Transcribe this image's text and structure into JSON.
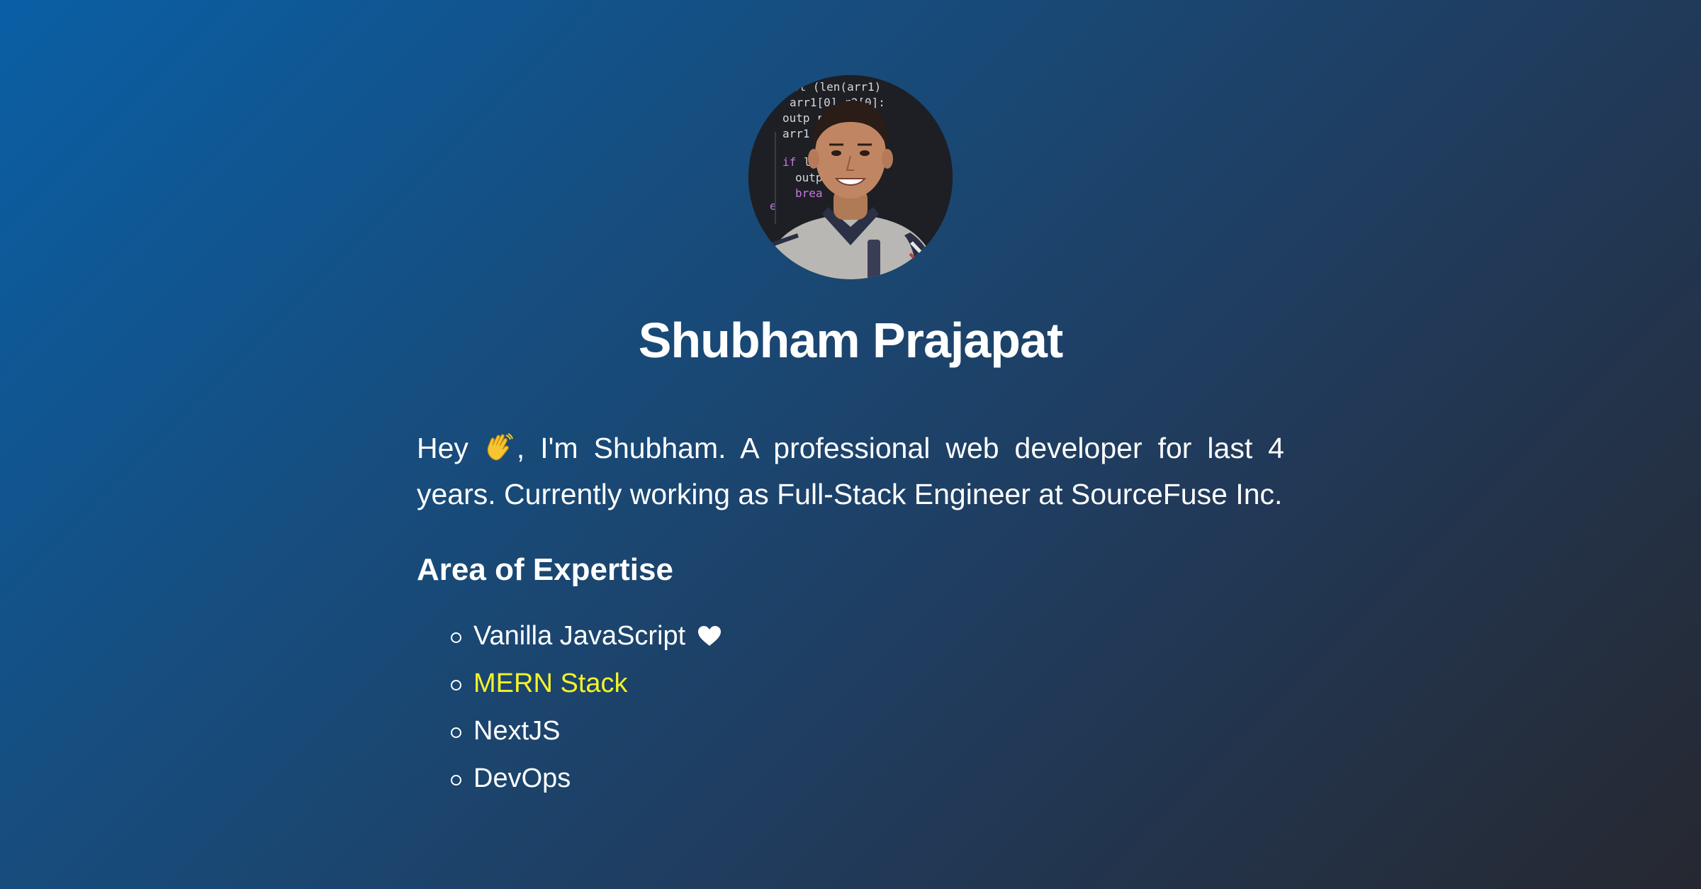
{
  "profile": {
    "name": "Shubham Prajapat",
    "avatar_icon": "profile-photo"
  },
  "intro": {
    "before_emoji": "Hey ",
    "emoji_icon": "waving-hand-icon",
    "after_emoji": ", I'm Shubham. A professional web developer for last 4 years. Currently working as Full-Stack Engineer at SourceFuse Inc."
  },
  "expertise": {
    "title": "Area of Expertise",
    "items": [
      {
        "label": "Vanilla JavaScript",
        "icon": "heart-icon"
      },
      {
        "label": "MERN Stack",
        "highlight": "#f3f32a"
      },
      {
        "label": "NextJS"
      },
      {
        "label": "DevOps"
      }
    ]
  },
  "colors": {
    "gradient_start": "#0a5fa5",
    "gradient_end": "#262830",
    "highlight": "#f3f32a",
    "text": "#ffffff"
  }
}
